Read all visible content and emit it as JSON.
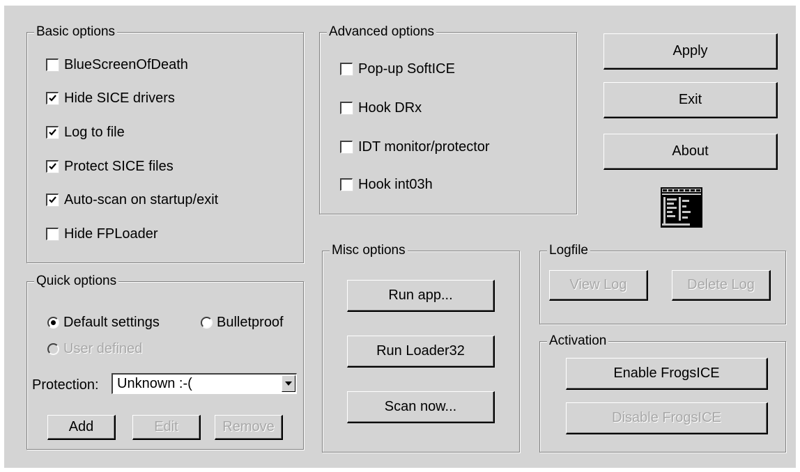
{
  "basic_options": {
    "title": "Basic options",
    "items": [
      {
        "label": "BlueScreenOfDeath",
        "checked": false
      },
      {
        "label": "Hide SICE drivers",
        "checked": true
      },
      {
        "label": "Log to file",
        "checked": true
      },
      {
        "label": "Protect SICE files",
        "checked": true
      },
      {
        "label": "Auto-scan on startup/exit",
        "checked": true
      },
      {
        "label": "Hide FPLoader",
        "checked": false
      }
    ]
  },
  "advanced_options": {
    "title": "Advanced options",
    "items": [
      {
        "label": "Pop-up SoftICE",
        "checked": false
      },
      {
        "label": "Hook DRx",
        "checked": false
      },
      {
        "label": "IDT monitor/protector",
        "checked": false
      },
      {
        "label": "Hook int03h",
        "checked": false
      }
    ]
  },
  "main_buttons": {
    "apply": "Apply",
    "exit": "Exit",
    "about": "About"
  },
  "quick_options": {
    "title": "Quick options",
    "radio_default": "Default settings",
    "radio_bulletproof": "Bulletproof",
    "radio_user_defined": "User defined",
    "selected": "Default settings",
    "protection_label": "Protection:",
    "protection_value": "Unknown :-(",
    "add": "Add",
    "edit": "Edit",
    "remove": "Remove"
  },
  "misc_options": {
    "title": "Misc options",
    "run_app": "Run app...",
    "run_loader": "Run Loader32",
    "scan_now": "Scan now..."
  },
  "logfile": {
    "title": "Logfile",
    "view_log": "View Log",
    "delete_log": "Delete Log"
  },
  "activation": {
    "title": "Activation",
    "enable": "Enable FrogsICE",
    "disable": "Disable FrogsICE"
  },
  "icons": {
    "checkmark": "checkmark-icon",
    "dropdown": "chevron-down-icon",
    "app": "program-window-icon"
  }
}
